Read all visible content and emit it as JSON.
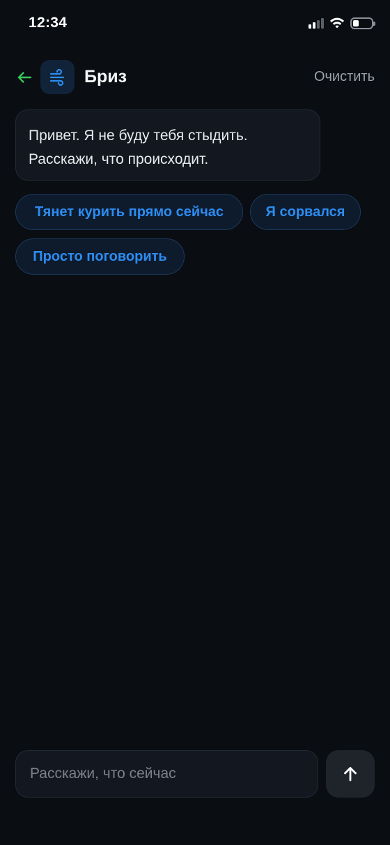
{
  "status_bar": {
    "time": "12:34"
  },
  "header": {
    "title": "Бриз",
    "clear_label": "Очистить",
    "back_icon": "arrow-left-icon",
    "avatar_icon": "wind-icon"
  },
  "messages": [
    {
      "from": "bot",
      "text": "Привет. Я не буду тебя стыдить. Расскажи, что происходит."
    }
  ],
  "quick_replies": [
    {
      "label": "Тянет курить прямо сейчас"
    },
    {
      "label": "Я сорвался"
    },
    {
      "label": "Просто поговорить"
    }
  ],
  "composer": {
    "placeholder": "Расскажи, что сейчас",
    "value": "",
    "send_icon": "arrow-up-icon"
  },
  "colors": {
    "background": "#0a0d12",
    "accent_blue": "#2d8cf0",
    "back_arrow_green": "#34c759",
    "bubble": "#131820"
  }
}
